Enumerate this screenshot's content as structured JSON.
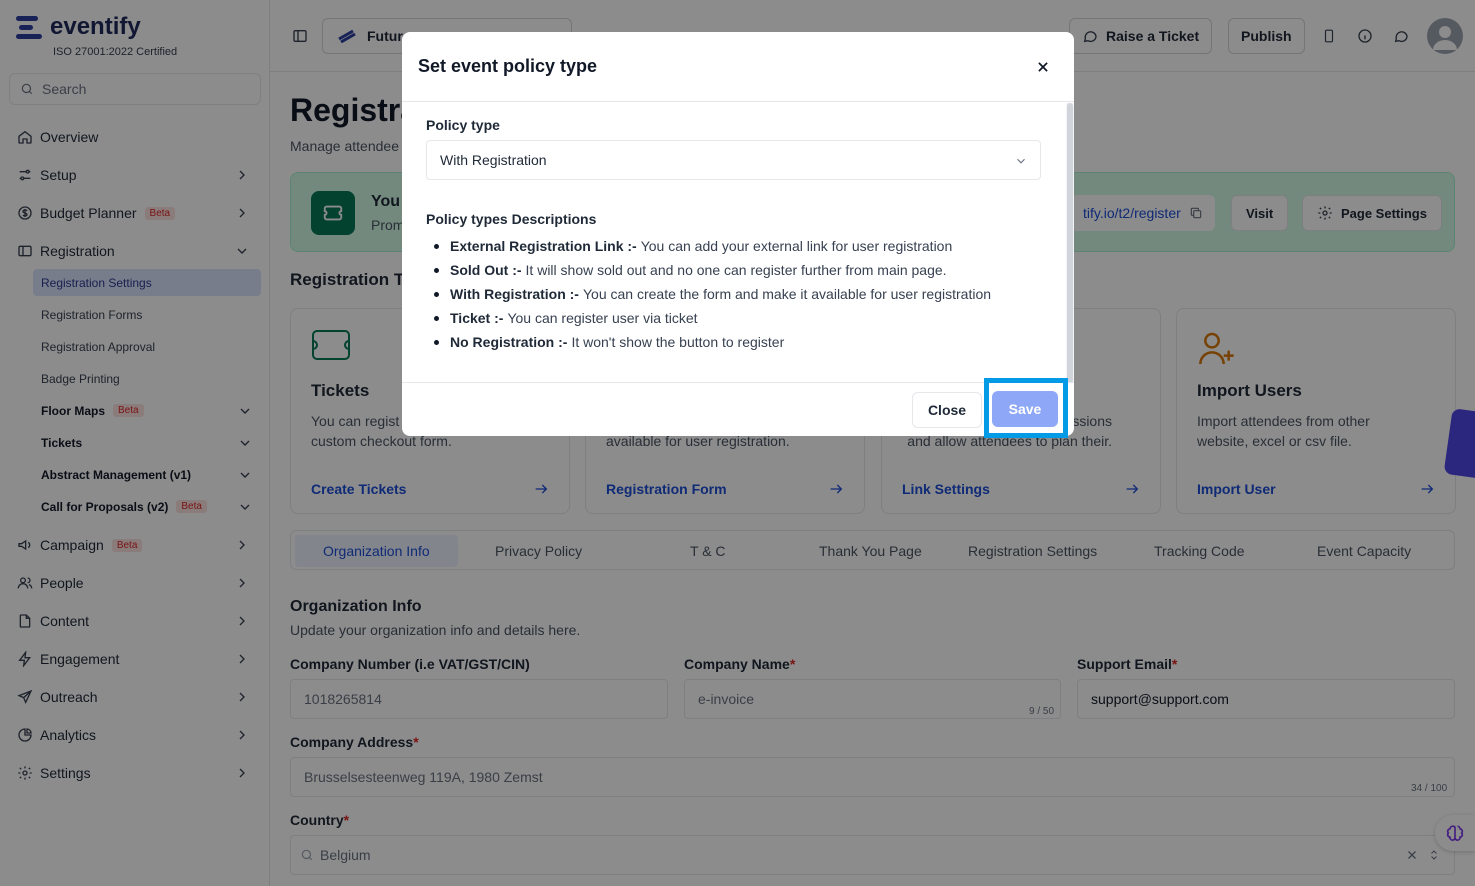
{
  "brand": {
    "name": "eventify",
    "certification": "ISO 27001:2022 Certified"
  },
  "search": {
    "placeholder": "Search"
  },
  "sidebar": {
    "items": [
      {
        "label": "Overview"
      },
      {
        "label": "Setup"
      },
      {
        "label": "Budget Planner",
        "badge": "Beta"
      },
      {
        "label": "Registration"
      },
      {
        "label": "Campaign",
        "badge": "Beta"
      },
      {
        "label": "People"
      },
      {
        "label": "Content"
      },
      {
        "label": "Engagement"
      },
      {
        "label": "Outreach"
      },
      {
        "label": "Analytics"
      },
      {
        "label": "Settings"
      }
    ],
    "registration_sub": [
      {
        "label": "Registration Settings"
      },
      {
        "label": "Registration Forms"
      },
      {
        "label": "Registration Approval"
      },
      {
        "label": "Badge Printing"
      },
      {
        "label": "Floor Maps",
        "badge": "Beta"
      },
      {
        "label": "Tickets"
      },
      {
        "label": "Abstract Management (v1)"
      },
      {
        "label": "Call for Proposals (v2)",
        "badge": "Beta"
      }
    ]
  },
  "topbar": {
    "event_name": "Futur",
    "raise_ticket": "Raise a Ticket",
    "publish": "Publish"
  },
  "main": {
    "title": "Registra",
    "subtitle": "Manage attendee",
    "banner": {
      "title": "You",
      "subtitle": "Prom",
      "link": "tify.io/t2/register",
      "visit": "Visit",
      "page_settings": "Page Settings"
    },
    "section_title": "Registration Ty",
    "cards": [
      {
        "title": "Tickets",
        "desc": "You can regist\ncustom checkout form.",
        "link": "Create Tickets"
      },
      {
        "title": "",
        "desc": "\navailable for user registration.",
        "link": "Registration Form"
      },
      {
        "title": "",
        "desc": "sessions\nand allow attendees to plan their.",
        "link": "Link Settings"
      },
      {
        "title": "Import Users",
        "desc": "Import attendees from other\nwebsite, excel or csv file.",
        "link": "Import User"
      }
    ],
    "tabs": [
      "Organization Info",
      "Privacy Policy",
      "T & C",
      "Thank You Page",
      "Registration Settings",
      "Tracking Code",
      "Event Capacity"
    ],
    "org": {
      "title": "Organization Info",
      "subtitle": "Update your organization info and details here.",
      "company_number_label": "Company Number (i.e VAT/GST/CIN)",
      "company_number_value": "1018265814",
      "company_name_label": "Company Name",
      "company_name_value": "e-invoice",
      "company_name_counter": "9 / 50",
      "support_email_label": "Support Email",
      "support_email_value": "support@support.com",
      "company_address_label": "Company Address",
      "company_address_value": "Brusselsesteenweg 119A, 1980 Zemst",
      "company_address_counter": "34 / 100",
      "country_label": "Country",
      "country_value": "Belgium"
    }
  },
  "modal": {
    "title": "Set event policy type",
    "policy_type_label": "Policy type",
    "policy_type_value": "With Registration",
    "descriptions_title": "Policy types Descriptions",
    "descriptions": [
      {
        "term": "External Registration Link :-",
        "text": "You can add your external link for user registration"
      },
      {
        "term": "Sold Out :-",
        "text": "It will show sold out and no one can register further from main page."
      },
      {
        "term": "With Registration :-",
        "text": "You can create the form and make it available for user registration"
      },
      {
        "term": "Ticket :-",
        "text": "You can register user via ticket"
      },
      {
        "term": "No Registration :-",
        "text": "It won't show the button to register"
      }
    ],
    "close_label": "Close",
    "save_label": "Save"
  },
  "colors": {
    "accent": "#1d4ed8",
    "highlight": "#039be5",
    "save_disabled": "#8ea7f6"
  }
}
